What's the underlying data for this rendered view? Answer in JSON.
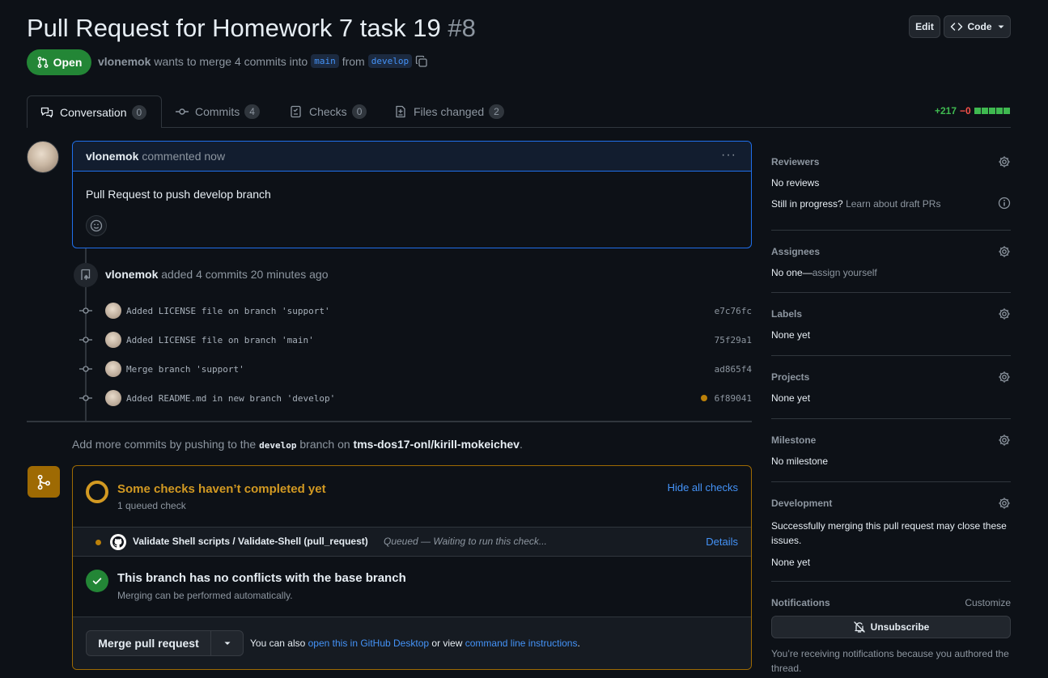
{
  "header": {
    "title": "Pull Request for Homework 7 task 19",
    "number": "#8",
    "edit_label": "Edit",
    "code_label": "Code",
    "status": "Open",
    "author": "vlonemok",
    "merge_text": "wants to merge 4 commits into",
    "base_branch": "main",
    "from_text": "from",
    "head_branch": "develop"
  },
  "tabs": [
    {
      "label": "Conversation",
      "count": "0"
    },
    {
      "label": "Commits",
      "count": "4"
    },
    {
      "label": "Checks",
      "count": "0"
    },
    {
      "label": "Files changed",
      "count": "2"
    }
  ],
  "diffstat": {
    "additions": "+217",
    "deletions": "−0"
  },
  "comment": {
    "author": "vlonemok",
    "time": "commented now",
    "body": "Pull Request to push develop branch"
  },
  "commits_event": {
    "author": "vlonemok",
    "text": "added 4 commits 20 minutes ago",
    "items": [
      {
        "message": "Added LICENSE file on branch 'support'",
        "sha": "e7c76fc"
      },
      {
        "message": "Added LICENSE file on branch 'main'",
        "sha": "75f29a1"
      },
      {
        "message": "Merge branch 'support'",
        "sha": "ad865f4"
      },
      {
        "message": "Added README.md in new branch 'develop'",
        "sha": "6f89041"
      }
    ]
  },
  "push_hint": {
    "prefix": "Add more commits by pushing to the",
    "branch": "develop",
    "middle": "branch on",
    "repo": "tms-dos17-onl/kirill-mokeichev",
    "suffix": "."
  },
  "checks": {
    "title": "Some checks haven’t completed yet",
    "subtitle": "1 queued check",
    "hide_label": "Hide all checks",
    "item_name": "Validate Shell scripts / Validate-Shell (pull_request)",
    "item_status": "Queued — Waiting to run this check...",
    "details_label": "Details",
    "conflict_title": "This branch has no conflicts with the base branch",
    "conflict_sub": "Merging can be performed automatically.",
    "merge_label": "Merge pull request",
    "also_text": "You can also",
    "desktop_link": "open this in GitHub Desktop",
    "or_text": "or view",
    "cli_link": "command line instructions",
    "end_dot": "."
  },
  "sidebar": {
    "reviewers": {
      "label": "Reviewers",
      "value": "No reviews",
      "progress": "Still in progress?",
      "draft_link": "Learn about draft PRs"
    },
    "assignees": {
      "label": "Assignees",
      "value": "No one—",
      "assign_link": "assign yourself"
    },
    "labels": {
      "label": "Labels",
      "value": "None yet"
    },
    "projects": {
      "label": "Projects",
      "value": "None yet"
    },
    "milestone": {
      "label": "Milestone",
      "value": "No milestone"
    },
    "development": {
      "label": "Development",
      "desc": "Successfully merging this pull request may close these issues.",
      "value": "None yet"
    },
    "notifications": {
      "label": "Notifications",
      "customize": "Customize",
      "unsubscribe": "Unsubscribe",
      "reason": "You’re receiving notifications because you authored the thread."
    }
  },
  "colors": {
    "open": "#238636",
    "accent": "#4493f8",
    "pending": "#bb8009",
    "success": "#238636"
  }
}
